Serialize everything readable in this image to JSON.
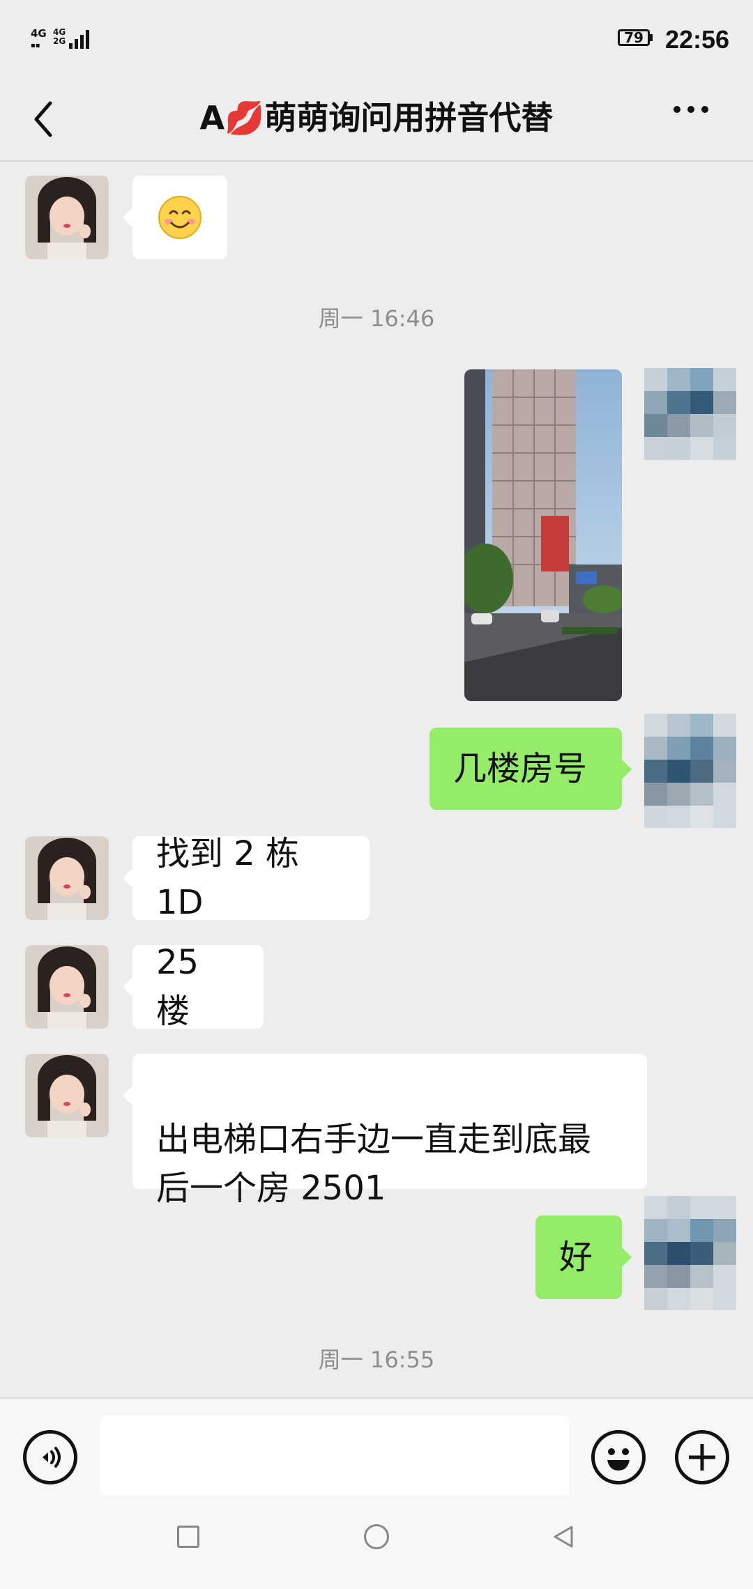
{
  "status_bar": {
    "network_top": "4G",
    "network_bottom_a": "4G",
    "network_bottom_b": "2G",
    "battery": "79",
    "time": "22:56"
  },
  "header": {
    "title": "A💋萌萌询问用拼音代替",
    "back_icon": "chevron-left-icon",
    "more_icon": "more-dots-icon"
  },
  "messages": [
    {
      "from": "them",
      "type": "emoji",
      "text": "😊"
    },
    {
      "type": "time",
      "text": "周一 16:46"
    },
    {
      "from": "me",
      "type": "image",
      "alt": "building photo"
    },
    {
      "from": "me",
      "type": "text",
      "text": "几楼房号"
    },
    {
      "from": "them",
      "type": "text",
      "text": "找到 2 栋 1D"
    },
    {
      "from": "them",
      "type": "text",
      "text": "25 楼"
    },
    {
      "from": "them",
      "type": "text",
      "text": "出电梯口右手边一直走到底最\n后一个房 2501"
    },
    {
      "from": "me",
      "type": "text",
      "text": "好"
    },
    {
      "type": "time",
      "text": "周一 16:55"
    }
  ],
  "input_bar": {
    "voice_icon": "voice-icon",
    "emoji_icon": "emoji-icon",
    "plus_icon": "plus-icon",
    "placeholder": ""
  },
  "nav": {
    "recent": "square-icon",
    "home": "circle-icon",
    "back": "triangle-back-icon"
  },
  "colors": {
    "background": "#ededed",
    "outgoing_bubble": "#95ec69",
    "incoming_bubble": "#ffffff",
    "timestamp": "#8d8d8d"
  }
}
